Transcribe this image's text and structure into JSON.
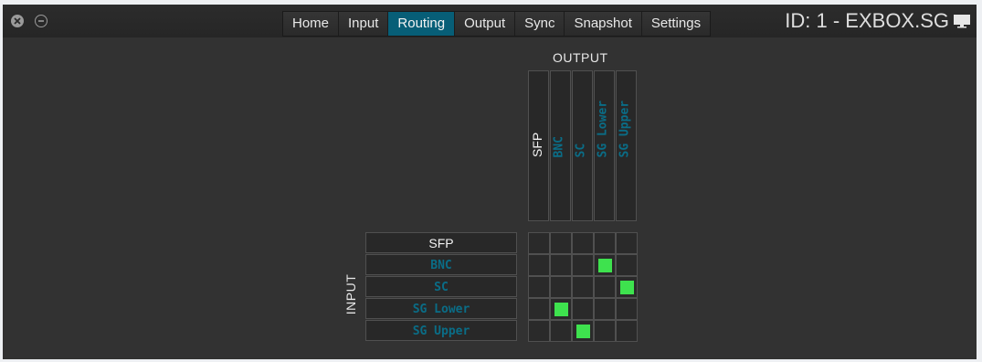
{
  "window_controls": {
    "close": "close-icon",
    "minimize": "minimize-icon"
  },
  "tabs": [
    {
      "label": "Home",
      "active": false
    },
    {
      "label": "Input",
      "active": false
    },
    {
      "label": "Routing",
      "active": true
    },
    {
      "label": "Output",
      "active": false
    },
    {
      "label": "Sync",
      "active": false
    },
    {
      "label": "Snapshot",
      "active": false
    },
    {
      "label": "Settings",
      "active": false
    }
  ],
  "device_id": "ID: 1 - EXBOX.SG",
  "device_icon": "monitor-icon",
  "colors": {
    "accent": "#075e77",
    "label_teal": "#0a6d87",
    "route_on": "#3ee24e",
    "background": "#323232"
  },
  "routing": {
    "output_title": "OUTPUT",
    "input_title": "INPUT",
    "outputs": [
      {
        "label": "SFP",
        "color": "white"
      },
      {
        "label": "BNC",
        "color": "teal"
      },
      {
        "label": "SC",
        "color": "teal"
      },
      {
        "label": "SG Lower",
        "color": "teal"
      },
      {
        "label": "SG Upper",
        "color": "teal"
      }
    ],
    "inputs": [
      {
        "label": "SFP",
        "color": "white"
      },
      {
        "label": "BNC",
        "color": "teal"
      },
      {
        "label": "SC",
        "color": "teal"
      },
      {
        "label": "SG Lower",
        "color": "teal"
      },
      {
        "label": "SG Upper",
        "color": "teal"
      }
    ],
    "routes": [
      {
        "input": "BNC",
        "output": "SG Lower"
      },
      {
        "input": "SC",
        "output": "SG Upper"
      },
      {
        "input": "SG Lower",
        "output": "BNC"
      },
      {
        "input": "SG Upper",
        "output": "SC"
      }
    ]
  }
}
